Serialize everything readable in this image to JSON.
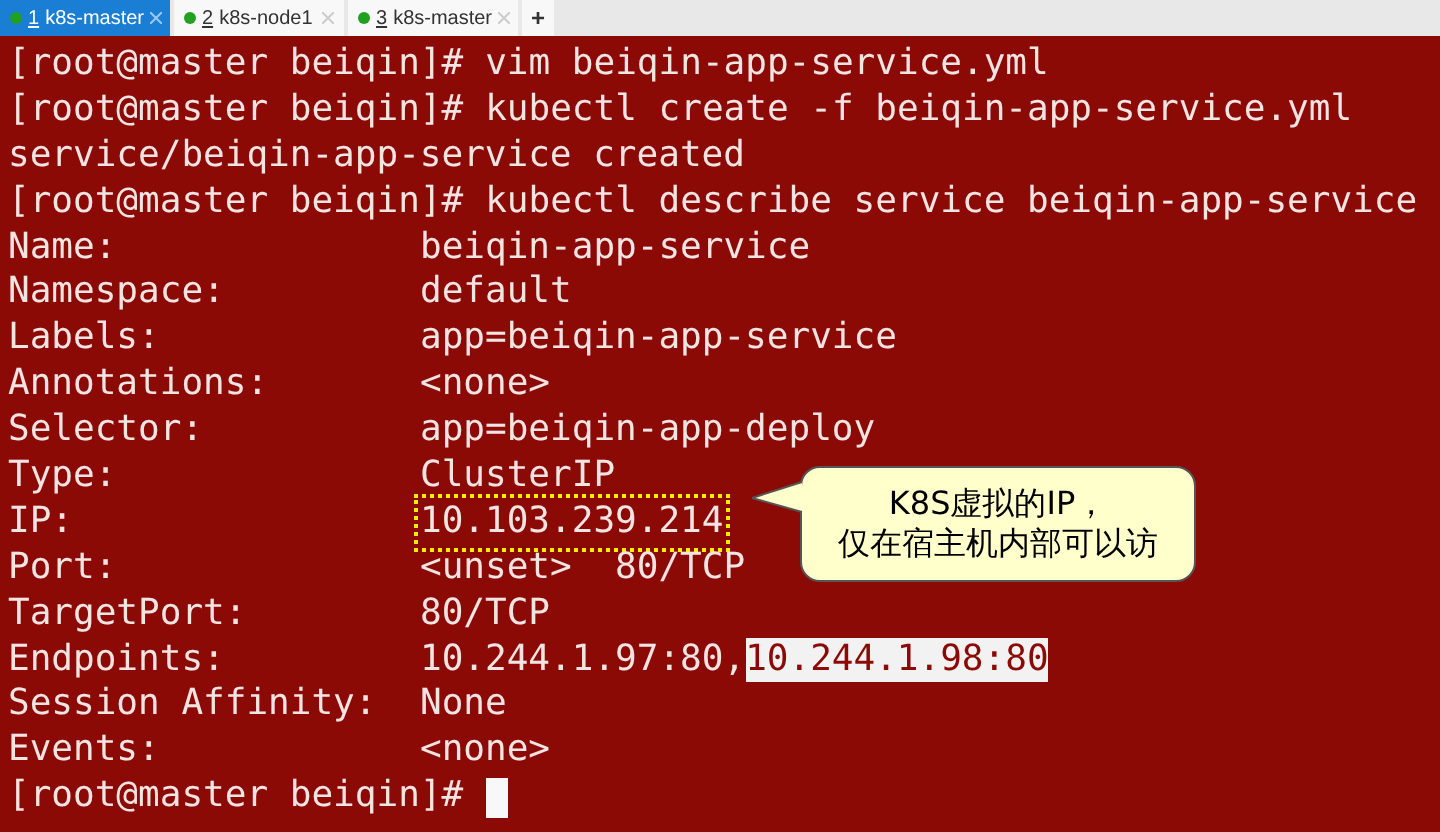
{
  "tabs": [
    {
      "number": "1",
      "label": "k8s-master",
      "selected": true
    },
    {
      "number": "2",
      "label": "k8s-node1",
      "selected": false
    },
    {
      "number": "3",
      "label": "k8s-master",
      "selected": false
    }
  ],
  "add_tab": "+",
  "terminal": {
    "lines": [
      {
        "kind": "command",
        "prompt": "[root@master beiqin]#",
        "command": "vim beiqin-app-service.yml"
      },
      {
        "kind": "command",
        "prompt": "[root@master beiqin]#",
        "command": "kubectl create -f beiqin-app-service.yml"
      },
      {
        "kind": "output",
        "text": "service/beiqin-app-service created"
      },
      {
        "kind": "command",
        "prompt": "[root@master beiqin]#",
        "command": "kubectl describe service beiqin-app-service"
      },
      {
        "kind": "field",
        "label": "Name:",
        "values": [
          {
            "text": "beiqin-app-service",
            "highlighted": false,
            "boxed": false
          }
        ]
      },
      {
        "kind": "field",
        "label": "Namespace:",
        "values": [
          {
            "text": "default",
            "highlighted": false,
            "boxed": false
          }
        ]
      },
      {
        "kind": "field",
        "label": "Labels:",
        "values": [
          {
            "text": "app=beiqin-app-service",
            "highlighted": false,
            "boxed": false
          }
        ]
      },
      {
        "kind": "field",
        "label": "Annotations:",
        "values": [
          {
            "text": "<none>",
            "highlighted": false,
            "boxed": false
          }
        ]
      },
      {
        "kind": "field",
        "label": "Selector:",
        "values": [
          {
            "text": "app=beiqin-app-deploy",
            "highlighted": false,
            "boxed": false
          }
        ]
      },
      {
        "kind": "field",
        "label": "Type:",
        "values": [
          {
            "text": "ClusterIP",
            "highlighted": false,
            "boxed": false
          }
        ]
      },
      {
        "kind": "field",
        "label": "IP:",
        "values": [
          {
            "text": "10.103.239.214",
            "highlighted": false,
            "boxed": true
          }
        ]
      },
      {
        "kind": "field",
        "label": "Port:",
        "values": [
          {
            "text": "<unset>  80/TCP",
            "highlighted": false,
            "boxed": false
          }
        ]
      },
      {
        "kind": "field",
        "label": "TargetPort:",
        "values": [
          {
            "text": "80/TCP",
            "highlighted": false,
            "boxed": false
          }
        ]
      },
      {
        "kind": "field",
        "label": "Endpoints:",
        "values": [
          {
            "text": "10.244.1.97:80,",
            "highlighted": false,
            "boxed": false
          },
          {
            "text": "10.244.1.98:80",
            "highlighted": true,
            "boxed": false
          }
        ]
      },
      {
        "kind": "field",
        "label": "Session Affinity:",
        "values": [
          {
            "text": "None",
            "highlighted": false,
            "boxed": false
          }
        ]
      },
      {
        "kind": "field",
        "label": "Events:",
        "values": [
          {
            "text": "<none>",
            "highlighted": false,
            "boxed": false
          }
        ]
      },
      {
        "kind": "cursor",
        "prompt": "[root@master beiqin]#"
      }
    ]
  },
  "callout": {
    "lines": [
      "K8S虚拟的IP，",
      "仅在宿主机内部可以访"
    ]
  }
}
